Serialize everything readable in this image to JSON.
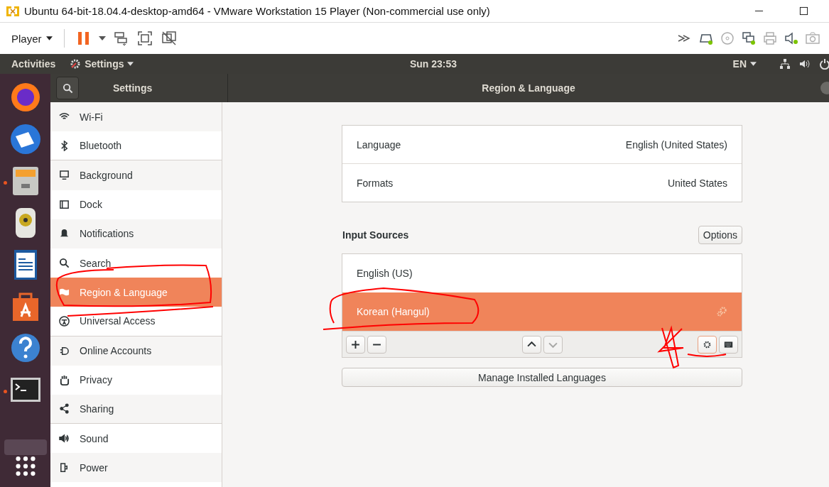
{
  "window": {
    "title": "Ubuntu 64-bit-18.04.4-desktop-amd64 - VMware Workstation 15 Player (Non-commercial use only)"
  },
  "toolbar": {
    "player_menu": "Player"
  },
  "topbar": {
    "activities": "Activities",
    "app_menu": "Settings",
    "clock": "Sun 23:53",
    "keyboard_layout": "EN"
  },
  "dock": {
    "apps": [
      {
        "running": false
      },
      {
        "running": false
      },
      {
        "running": true
      },
      {
        "running": false
      },
      {
        "running": false
      },
      {
        "running": false
      },
      {
        "running": false
      },
      {
        "running": true
      },
      {
        "running": false
      }
    ]
  },
  "header": {
    "sidebar_title": "Settings",
    "panel_title": "Region & Language"
  },
  "sidebar": {
    "items": [
      {
        "label": "Wi-Fi",
        "selected": false
      },
      {
        "label": "Bluetooth",
        "selected": false
      },
      {
        "label": "Background",
        "selected": false
      },
      {
        "label": "Dock",
        "selected": false
      },
      {
        "label": "Notifications",
        "selected": false
      },
      {
        "label": "Search",
        "selected": false
      },
      {
        "label": "Region & Language",
        "selected": true
      },
      {
        "label": "Universal Access",
        "selected": false
      },
      {
        "label": "Online Accounts",
        "selected": false
      },
      {
        "label": "Privacy",
        "selected": false
      },
      {
        "label": "Sharing",
        "selected": false
      },
      {
        "label": "Sound",
        "selected": false
      },
      {
        "label": "Power",
        "selected": false
      }
    ]
  },
  "language_settings": [
    {
      "label": "Language",
      "value": "English (United States)"
    },
    {
      "label": "Formats",
      "value": "United States"
    }
  ],
  "input_sources": {
    "title": "Input Sources",
    "options_button": "Options",
    "items": [
      {
        "label": "English (US)",
        "selected": false
      },
      {
        "label": "Korean (Hangul)",
        "selected": true
      }
    ],
    "move_up": {
      "disabled": false
    },
    "move_down": {
      "disabled": true
    }
  },
  "manage_button": "Manage Installed Languages"
}
